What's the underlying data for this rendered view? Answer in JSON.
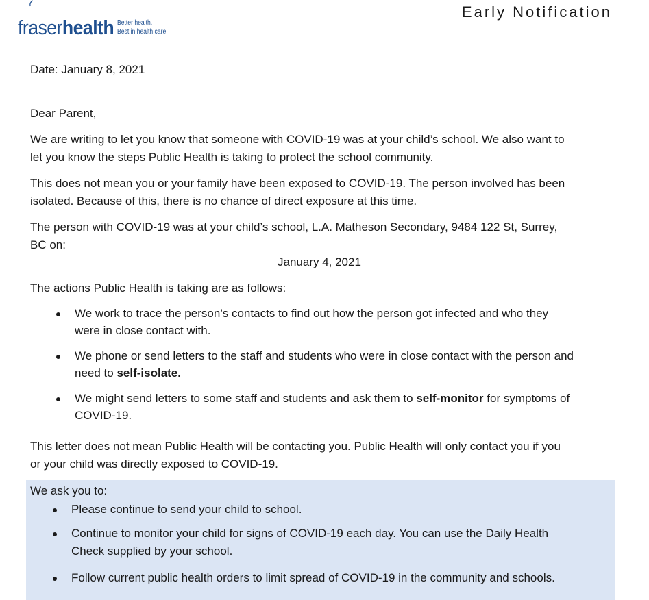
{
  "header": {
    "logo_light": "fraser",
    "logo_bold": "health",
    "tagline_line1": "Better health.",
    "tagline_line2": "Best in health care.",
    "title": "Early Notification",
    "brand_color": "#1f4f8f",
    "accent_color": "#f28c28"
  },
  "letter": {
    "date": "Date: January 8, 2021",
    "salutation": "Dear Parent,",
    "p1_line1": "We are writing to let you know that someone with COVID-19 was at your child’s school. We also want to",
    "p1_line2": "let you know the steps Public Health is taking to protect the school community.",
    "p2_line1": "This does not mean you or your family have been exposed to COVID-19. The person involved has been",
    "p2_line2": "isolated. Because of this, there is no chance of direct exposure at this time.",
    "p3_line1": "The person with COVID-19 was at your child’s school, L.A. Matheson Secondary, 9484 122 St, Surrey,",
    "p3_line2": "BC on:",
    "exposure_date": "January 4, 2021",
    "actions_intro": "The actions Public Health is taking are as follows:",
    "actions": [
      {
        "line1": "We work to trace the person’s contacts to find out how the person got infected and who they",
        "line2": "were in close contact with."
      },
      {
        "line1": "We phone or send letters to the staff and students who were in close contact with the person and",
        "line2_prefix": "need to ",
        "line2_bold": "self-isolate."
      },
      {
        "line1_prefix": "We might send letters to some staff and students and ask them to ",
        "line1_bold": "self-monitor",
        "line1_suffix": " for symptoms of",
        "line2": "COVID-19."
      }
    ],
    "p4_line1": "This letter does not mean Public Health will be contacting you. Public Health will only contact you if you",
    "p4_line2": "or your child was directly exposed to COVID-19.",
    "ask": {
      "intro": "We ask you to:",
      "box_color": "#dbe5f4",
      "items": [
        {
          "line1": "Please continue to send your child to school."
        },
        {
          "line1": "Continue to monitor your child for signs of COVID-19 each day.  You can use the Daily Health",
          "line2": "Check supplied by your school."
        },
        {
          "line1": "Follow current public health orders to limit spread of COVID-19 in the community and schools."
        }
      ]
    }
  }
}
